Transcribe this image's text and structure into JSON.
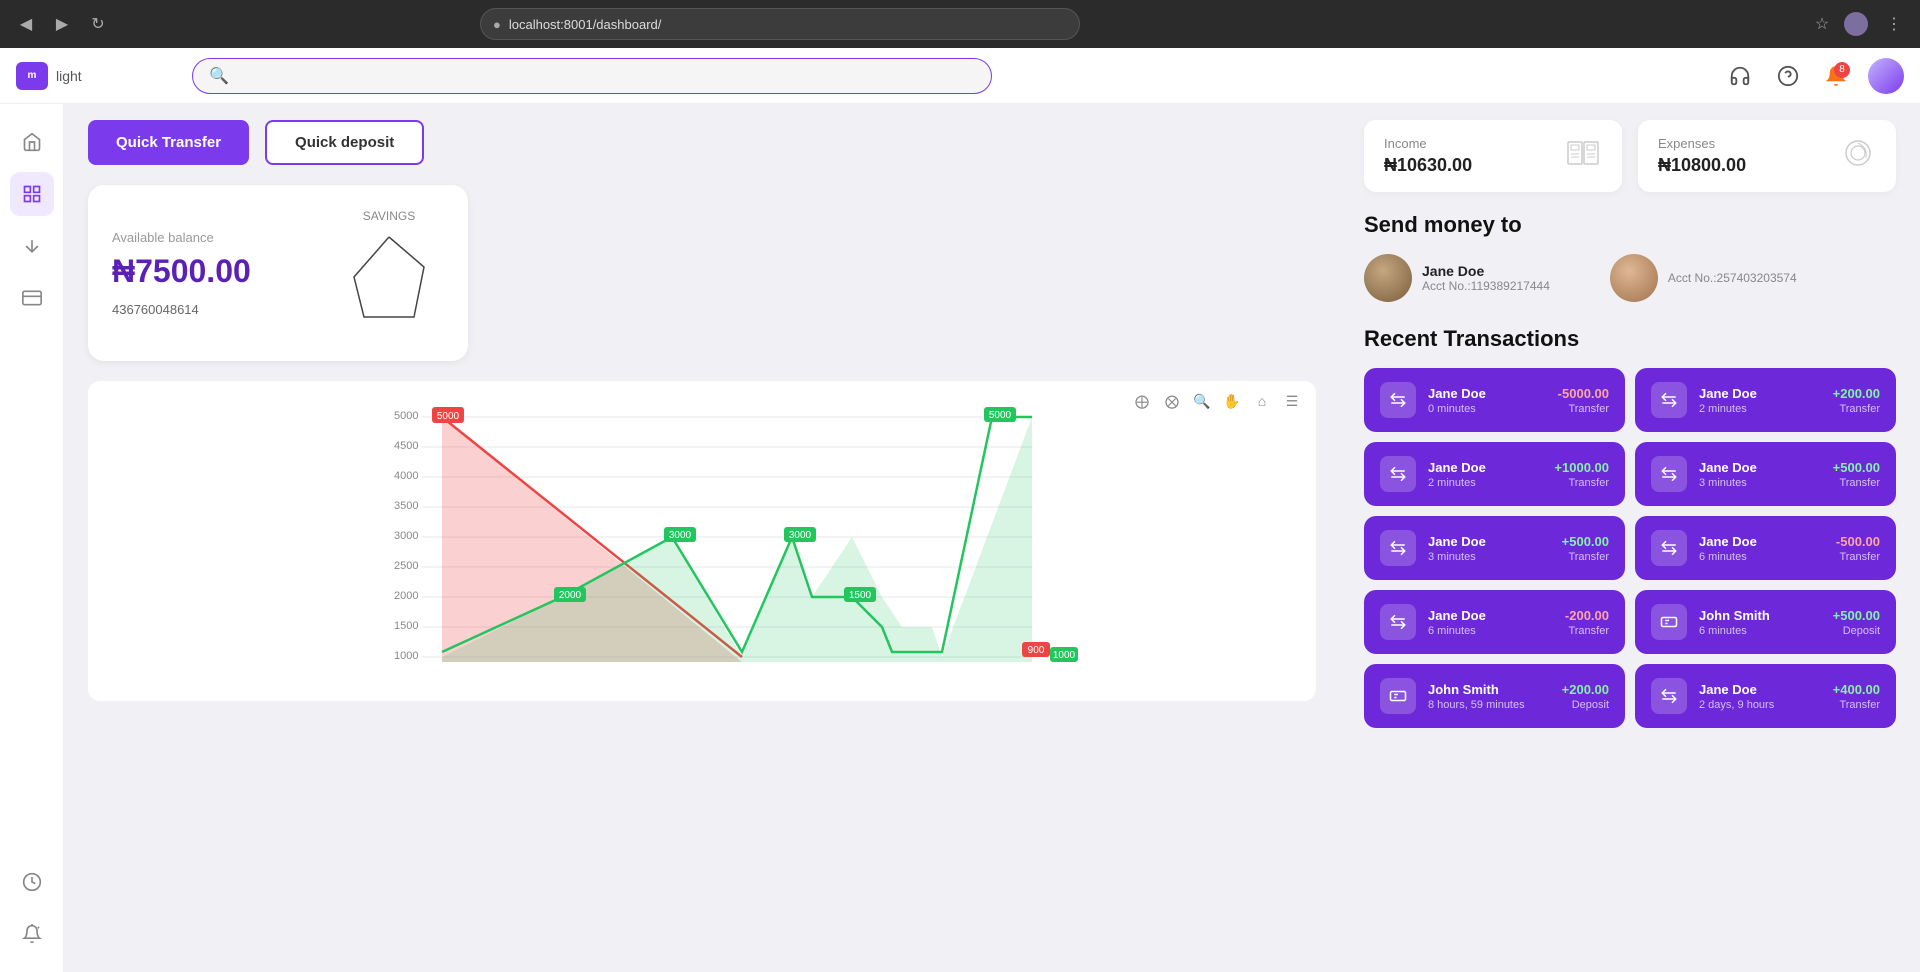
{
  "browser": {
    "url": "localhost:8001/dashboard/",
    "back_icon": "◀",
    "forward_icon": "▶",
    "refresh_icon": "↻"
  },
  "topbar": {
    "logo_text": "light",
    "logo_abbr": "m",
    "search_placeholder": "",
    "search_icon": "🔍",
    "help_icon": "?",
    "headset_icon": "🎧",
    "notification_icon": "🔔",
    "notification_count": "8",
    "more_icon": "⋮"
  },
  "sidebar": {
    "items": [
      {
        "id": "home",
        "icon": "⌂",
        "label": "Home"
      },
      {
        "id": "dashboard",
        "icon": "▦",
        "label": "Dashboard"
      },
      {
        "id": "transfers",
        "icon": "⇅",
        "label": "Transfers"
      },
      {
        "id": "wallet",
        "icon": "▣",
        "label": "Wallet"
      },
      {
        "id": "history",
        "icon": "◷",
        "label": "History"
      },
      {
        "id": "notifications",
        "icon": "🔔+",
        "label": "Notifications"
      }
    ]
  },
  "quick_buttons": {
    "transfer_label": "Quick Transfer",
    "deposit_label": "Quick deposit"
  },
  "balance_card": {
    "available_label": "Available balance",
    "amount": "₦7500.00",
    "account_number": "436760048614",
    "savings_label": "SAVINGS"
  },
  "stats": {
    "income_label": "Income",
    "income_value": "₦10630.00",
    "expenses_label": "Expenses",
    "expenses_value": "₦10800.00"
  },
  "send_money": {
    "title": "Send money to",
    "persons": [
      {
        "name": "Jane Doe",
        "acct": "Acct No.:119389217444",
        "avatar_color": "#8b7355"
      },
      {
        "name": "",
        "acct": "Acct No.:257403203574",
        "avatar_color": "#c4a882"
      }
    ]
  },
  "transactions": {
    "title": "Recent Transactions",
    "items": [
      {
        "name": "Jane Doe",
        "time": "0 minutes",
        "amount": "-5000.00",
        "type": "Transfer",
        "positive": false
      },
      {
        "name": "Jane Doe",
        "time": "2 minutes",
        "amount": "+200.00",
        "type": "Transfer",
        "positive": true
      },
      {
        "name": "Jane Doe",
        "time": "2 minutes",
        "amount": "+1000.00",
        "type": "Transfer",
        "positive": true
      },
      {
        "name": "Jane Doe",
        "time": "3 minutes",
        "amount": "+500.00",
        "type": "Transfer",
        "positive": true
      },
      {
        "name": "Jane Doe",
        "time": "3 minutes",
        "amount": "+500.00",
        "type": "Transfer",
        "positive": true
      },
      {
        "name": "Jane Doe",
        "time": "6 minutes",
        "amount": "-500.00",
        "type": "Transfer",
        "positive": false
      },
      {
        "name": "Jane Doe",
        "time": "6 minutes",
        "amount": "-200.00",
        "type": "Transfer",
        "positive": false
      },
      {
        "name": "John Smith",
        "time": "6 minutes",
        "amount": "+500.00",
        "type": "Deposit",
        "positive": true,
        "deposit_icon": true
      },
      {
        "name": "John Smith",
        "time": "8 hours, 59 minutes",
        "amount": "+200.00",
        "type": "Deposit",
        "positive": true,
        "deposit_icon": true
      },
      {
        "name": "Jane Doe",
        "time": "2 days, 9 hours",
        "amount": "+400.00",
        "type": "Transfer",
        "positive": true
      }
    ]
  },
  "chart": {
    "y_labels": [
      "5000",
      "4500",
      "4000",
      "3500",
      "3000",
      "2500",
      "2000",
      "1500",
      "1000"
    ],
    "data_points": {
      "red_label": "5000",
      "green_label": "5000",
      "mid_green": "2000",
      "point_3000a": "3000",
      "point_3000b": "3000",
      "point_1500": "1500",
      "point_900": "900",
      "point_1000a": "1000",
      "point_1000b": "1000"
    }
  }
}
